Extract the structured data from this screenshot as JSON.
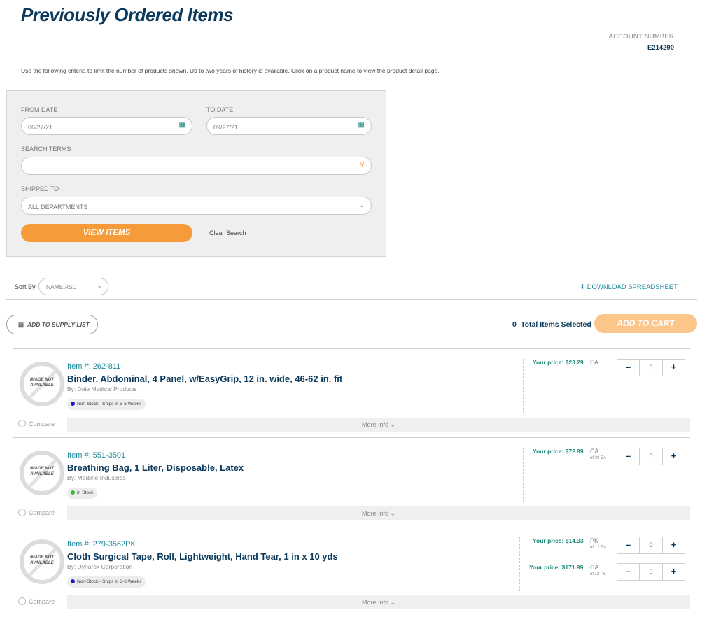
{
  "header": {
    "title": "Previously Ordered Items",
    "account_label": "ACCOUNT NUMBER",
    "account_number": "E214290"
  },
  "instructions": "Use the following criteria to limit the number of products shown. Up to two years of history is available. Click on a product name to view the product detail page.",
  "filters": {
    "from_label": "FROM DATE",
    "from_value": "06/27/21",
    "to_label": "TO DATE",
    "to_value": "09/27/21",
    "search_label": "SEARCH TERMS",
    "search_value": "",
    "shipped_label": "SHIPPED TO",
    "shipped_value": "ALL DEPARTMENTS",
    "view_button": "VIEW ITEMS",
    "clear_link": "Clear Search"
  },
  "sort": {
    "label": "Sort By",
    "value": "NAME ASC"
  },
  "download_label": "DOWNLOAD SPREADSHEET",
  "supply_list_label": "ADD TO SUPPLY LIST",
  "total_count": "0",
  "total_label": "Total Items Selected",
  "add_to_cart_label": "ADD TO CART",
  "no_image_text": "IMAGE NOT AVAILABLE",
  "compare_label": "Compare",
  "more_info_label": "More Info",
  "price_label": "Your price:",
  "colors": {
    "brand_navy": "#0b3a5c",
    "accent_orange": "#f59b39",
    "teal": "#1d8a9c",
    "in_stock": "#33bb33",
    "non_stock": "#1a1acc"
  },
  "icons": {
    "calendar": "calendar-icon",
    "search": "search-icon",
    "dropdown": "chevron-down-icon",
    "download": "download-icon",
    "list": "list-icon"
  },
  "items": [
    {
      "item_number": "Item #: 262-811",
      "name": "Binder, Abdominal, 4 Panel, w/EasyGrip, 12 in. wide, 46-62 in. fit",
      "by": "By: Dale Medical Products",
      "stock": "Non-Stock - Ships In 3-6 Weeks",
      "stock_type": "non-stock",
      "prices": [
        {
          "price": "$23.29",
          "unit": "EA",
          "unit_sub": "",
          "qty": "0"
        }
      ]
    },
    {
      "item_number": "Item #: 551-3501",
      "name": "Breathing Bag, 1 Liter, Disposable, Latex",
      "by": "By: Medline Industries",
      "stock": "In Stock",
      "stock_type": "in-stock",
      "prices": [
        {
          "price": "$72.99",
          "unit": "CA",
          "unit_sub": "of 30 EA",
          "qty": "0"
        }
      ]
    },
    {
      "item_number": "Item #: 279-3562PK",
      "name": "Cloth Surgical Tape, Roll, Lightweight, Hand Tear, 1 in x 10 yds",
      "by": "By: Dynarex Corporation",
      "stock": "Non-Stock - Ships In 3-6 Weeks",
      "stock_type": "non-stock",
      "prices": [
        {
          "price": "$14.33",
          "unit": "PK",
          "unit_sub": "of 12 EA",
          "qty": "0"
        },
        {
          "price": "$171.99",
          "unit": "CA",
          "unit_sub": "of 12 PK",
          "qty": "0"
        }
      ]
    }
  ]
}
